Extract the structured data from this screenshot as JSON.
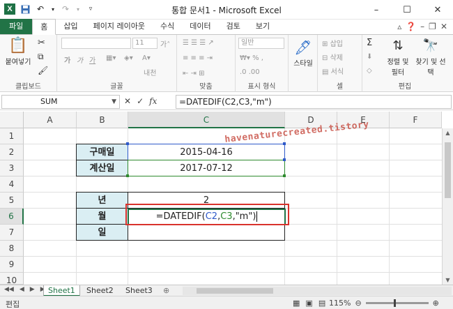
{
  "window": {
    "title": "통합 문서1 - Microsoft Excel",
    "app_icon": "X",
    "buttons": {
      "minimize": "–",
      "maximize": "☐",
      "close": "✕"
    }
  },
  "ribbon_tabs": [
    "파일",
    "홈",
    "삽입",
    "페이지 레이아웃",
    "수식",
    "데이터",
    "검토",
    "보기"
  ],
  "active_tab": "홈",
  "ribbon": {
    "clipboard": {
      "paste": "붙여넣기",
      "label": "클립보드"
    },
    "font": {
      "name": "",
      "size": "11",
      "label": "글꼴",
      "bold": "가",
      "italic": "가",
      "underline": "가",
      "grow": "가˄",
      "shrink": "가˅",
      "phonetic": "내천"
    },
    "alignment": {
      "label": "맞춤"
    },
    "number": {
      "format": "일반",
      "label": "표시 형식"
    },
    "styles": {
      "button": "스타일"
    },
    "cells": {
      "insert": "삽입",
      "delete": "삭제",
      "format": "서식",
      "label": "셀"
    },
    "editing": {
      "sort": "정렬 및 필터",
      "find": "찾기 및 선택",
      "label": "편집",
      "sum": "Σ"
    }
  },
  "formula_bar": {
    "name_box": "SUM",
    "cancel": "✕",
    "enter": "✓",
    "fx": "fx",
    "formula": "=DATEDIF(C2,C3,\"m\")"
  },
  "grid": {
    "columns": [
      "A",
      "B",
      "C",
      "D",
      "E",
      "F"
    ],
    "rows": [
      "1",
      "2",
      "3",
      "4",
      "5",
      "6",
      "7",
      "8",
      "9",
      "10"
    ],
    "selected_column": "C",
    "selected_row": "6",
    "cells": {
      "B2": "구매일",
      "C2": "2015-04-16",
      "B3": "계산일",
      "C3": "2017-07-12",
      "B5": "년",
      "C5": "2",
      "B6": "월",
      "B7": "일"
    },
    "editing_cell": {
      "prefix": "=DATEDIF(",
      "ref1": "C2",
      "comma1": ",",
      "ref2": "C3",
      "suffix": ",\"m\")"
    },
    "watermark": "havenaturecreated.tistory"
  },
  "sheets": [
    "Sheet1",
    "Sheet2",
    "Sheet3"
  ],
  "active_sheet": "Sheet1",
  "status_bar": {
    "mode": "편집",
    "zoom": "115%"
  },
  "colors": {
    "accent": "#217346",
    "label_fill": "#daeef3",
    "highlight_box": "#d9322d"
  }
}
